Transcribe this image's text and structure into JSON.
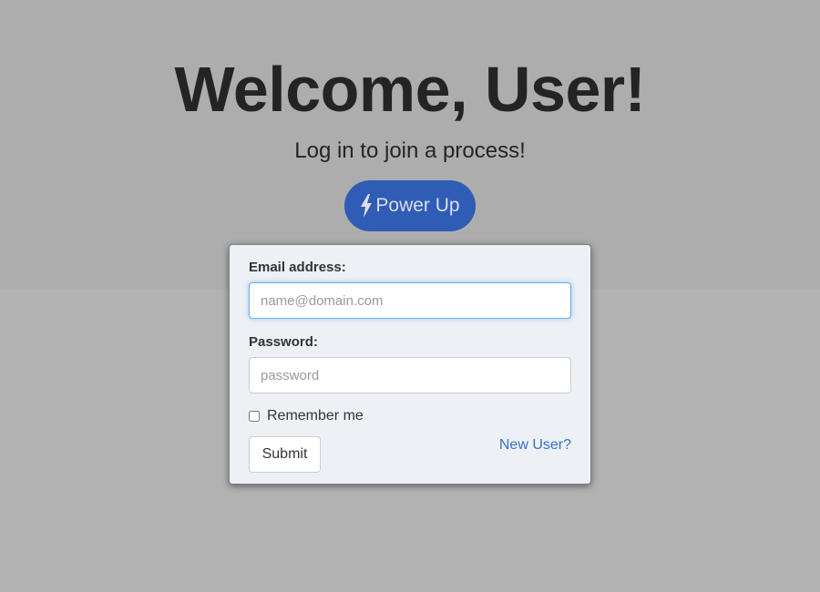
{
  "hero": {
    "title": "Welcome, User!",
    "subtitle": "Log in to join a process!",
    "power_button_label": "Power Up",
    "power_icon": "lightning-bolt-icon"
  },
  "login_form": {
    "email_label": "Email address:",
    "email_placeholder": "name@domain.com",
    "email_value": "",
    "password_label": "Password:",
    "password_placeholder": "password",
    "password_value": "",
    "remember_label": "Remember me",
    "remember_checked": false,
    "submit_label": "Submit",
    "new_user_label": "New User?"
  },
  "colors": {
    "page_background": "#b2b2b2",
    "hero_background": "#adadad",
    "button_primary": "#2f5cb5",
    "card_background": "#edf0f5",
    "link": "#3b6fc4",
    "focus": "#66afe9"
  }
}
